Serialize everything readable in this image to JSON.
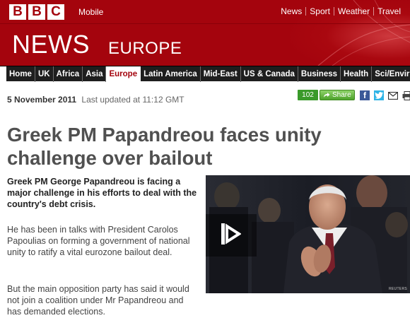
{
  "masthead": {
    "logo_letters": [
      "B",
      "B",
      "C"
    ],
    "platform_label": "Mobile",
    "top_links": [
      "News",
      "Sport",
      "Weather",
      "Travel"
    ],
    "section_title": "NEWS",
    "edition": "EUROPE",
    "brand_color": "#a4040d"
  },
  "nav": {
    "items": [
      "Home",
      "UK",
      "Africa",
      "Asia",
      "Europe",
      "Latin America",
      "Mid-East",
      "US & Canada",
      "Business",
      "Health",
      "Sci/Envir"
    ],
    "active_item": "Europe"
  },
  "article": {
    "date": "5 November 2011",
    "last_updated": "Last updated at 11:12 GMT",
    "share_count": "102",
    "share_label": "Share",
    "social_icons": [
      "facebook-icon",
      "twitter-icon",
      "email-icon",
      "print-icon"
    ],
    "headline_line1": "Greek PM Papandreou faces unity",
    "headline_line2": "challenge over bailout",
    "intro": "Greek PM George Papandreou is facing a major challenge in his efforts to deal with the country's debt crisis.",
    "paragraphs": [
      "He has been in talks with President Carolos Papoulias on forming a government of national unity to ratify a vital eurozone bailout deal.",
      "But the main opposition party has said it would not join a coalition under Mr Papandreou and has demanded elections."
    ],
    "media": {
      "play_icon": "play-icon",
      "credit": "REUTERS"
    }
  }
}
